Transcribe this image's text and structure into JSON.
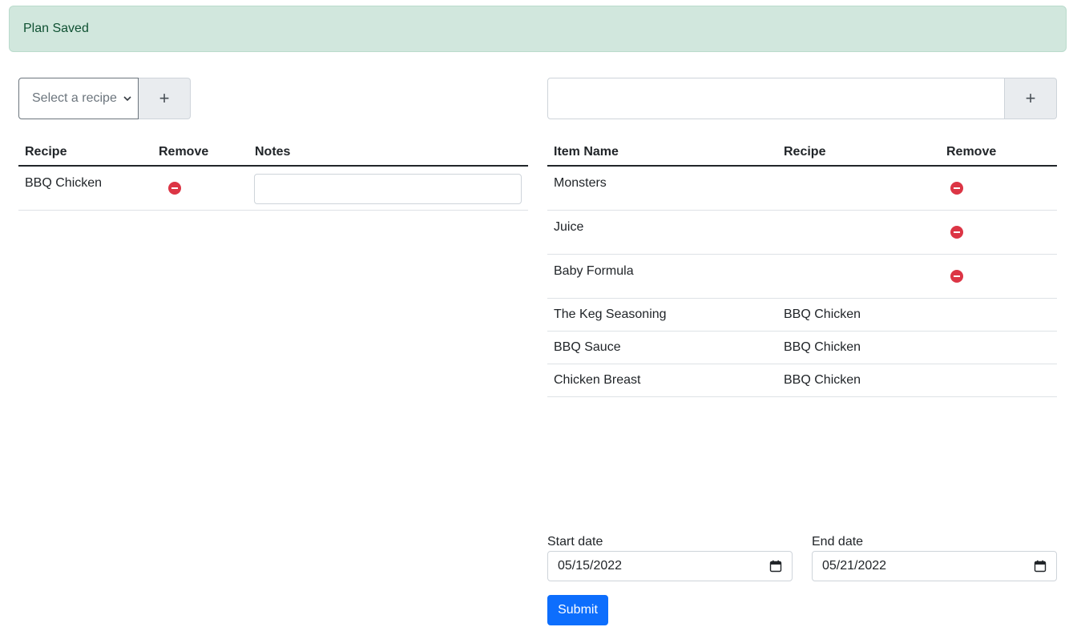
{
  "alert": {
    "text": "Plan Saved"
  },
  "left": {
    "select": {
      "placeholder": "Select a recipe",
      "add_label": "+"
    },
    "table": {
      "headers": {
        "recipe": "Recipe",
        "remove": "Remove",
        "notes": "Notes"
      },
      "rows": [
        {
          "recipe": "BBQ Chicken",
          "notes": ""
        }
      ]
    }
  },
  "right": {
    "item_input": {
      "value": "",
      "add_label": "+"
    },
    "table": {
      "headers": {
        "item_name": "Item Name",
        "recipe": "Recipe",
        "remove": "Remove"
      },
      "rows": [
        {
          "item_name": "Monsters",
          "recipe": "",
          "removable": true
        },
        {
          "item_name": "Juice",
          "recipe": "",
          "removable": true
        },
        {
          "item_name": "Baby Formula",
          "recipe": "",
          "removable": true
        },
        {
          "item_name": "The Keg Seasoning",
          "recipe": "BBQ Chicken",
          "removable": false
        },
        {
          "item_name": "BBQ Sauce",
          "recipe": "BBQ Chicken",
          "removable": false
        },
        {
          "item_name": "Chicken Breast",
          "recipe": "BBQ Chicken",
          "removable": false
        }
      ]
    }
  },
  "dates": {
    "start_label": "Start date",
    "start_value": "05/15/2022",
    "end_label": "End date",
    "end_value": "05/21/2022"
  },
  "submit_label": "Submit",
  "colors": {
    "alert_bg": "#d1e7dd",
    "alert_text": "#0f5132",
    "remove": "#dc3545",
    "primary": "#0d6efd"
  },
  "icons": {
    "remove": "remove-circle-icon",
    "calendar": "calendar-icon",
    "chevron": "chevron-down-icon"
  }
}
